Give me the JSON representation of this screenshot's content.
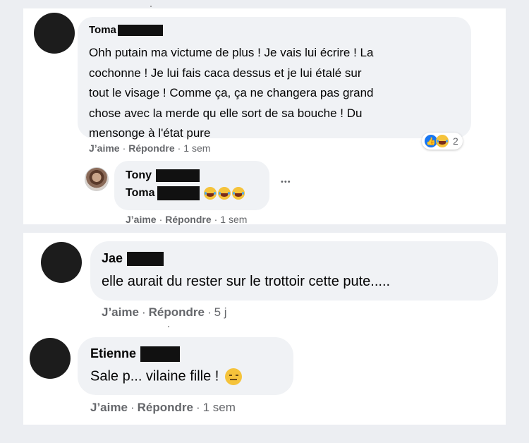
{
  "comments_top": {
    "toma": {
      "name": "Toma",
      "lines": [
        "Ohh putain ma victume de plus ! Je vais lui écrire ! La",
        "cochonne ! Je lui fais caca dessus et je lui étalé sur",
        "tout le visage ! Comme ça, ça ne changera pas grand",
        "chose avec la merde qu elle sort de sa bouche ! Du",
        "mensonge à l'état pure"
      ],
      "like_label": "J’aime",
      "reply_label": "Répondre",
      "time": "1 sem",
      "reaction_count": "2",
      "reaction_icons": [
        "like-icon",
        "haha-icon"
      ]
    },
    "tony_reply": {
      "name": "Tony",
      "mention": "Toma",
      "emoji_icon": "tears-of-joy-emoji",
      "like_label": "J’aime",
      "reply_label": "Répondre",
      "time": "1 sem",
      "more_label": "•••"
    }
  },
  "comments_bottom": {
    "jae": {
      "name": "Jae",
      "text": "elle aurait du rester sur le trottoir cette pute.....",
      "like_label": "J’aime",
      "reply_label": "Répondre",
      "time": "5 j"
    },
    "etienne": {
      "name": "Etienne",
      "text": "Sale p... vilaine fille !",
      "emoji_icon": "expressionless-emoji",
      "like_label": "J’aime",
      "reply_label": "Répondre",
      "time": "1 sem"
    }
  },
  "colors": {
    "bubble": "#f0f2f5",
    "meta_text": "#65676b",
    "like_blue": "#1877f2",
    "background": "#eceef2"
  }
}
